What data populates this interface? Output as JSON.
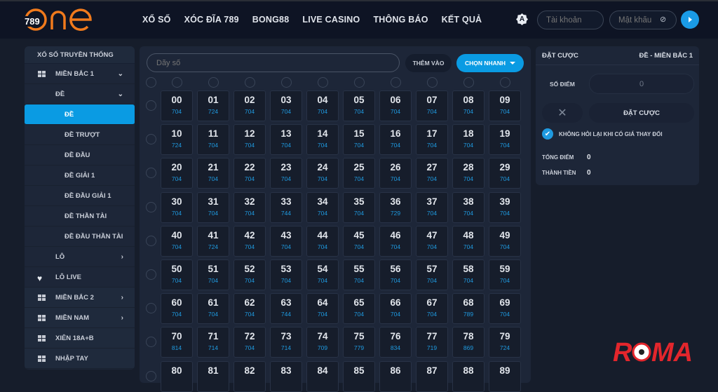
{
  "header": {
    "logo": {
      "prefix": "789",
      "word": "one"
    },
    "nav": [
      "XỔ SỐ",
      "XÓC ĐĨA 789",
      "BONG88",
      "LIVE CASINO",
      "THÔNG BÁO",
      "KẾT QUẢ"
    ],
    "lang_badge": "A",
    "username_placeholder": "Tài khoản",
    "password_placeholder": "Mật khẩu",
    "accent": "#1a9be6"
  },
  "sidebar": {
    "title": "XỔ SỐ TRUYỀN THỐNG",
    "items": [
      {
        "label": "MIỀN BẮC 1",
        "icon": "grid-icon",
        "chevron": "down",
        "level": 0
      },
      {
        "label": "ĐỀ",
        "chevron": "down",
        "level": 1
      },
      {
        "label": "ĐỀ",
        "level": 2,
        "active": true
      },
      {
        "label": "ĐỀ TRƯỢT",
        "level": 2
      },
      {
        "label": "ĐỀ ĐẦU",
        "level": 2
      },
      {
        "label": "ĐỀ GIẢI 1",
        "level": 2
      },
      {
        "label": "ĐỀ ĐẦU GIẢI 1",
        "level": 2
      },
      {
        "label": "ĐỀ THẦN TÀI",
        "level": 2
      },
      {
        "label": "ĐỀ ĐẦU THẦN TÀI",
        "level": 2
      },
      {
        "label": "LÔ",
        "chevron": "right",
        "level": 1
      },
      {
        "label": "LÔ LIVE",
        "icon": "heart-icon",
        "level": 0
      },
      {
        "label": "MIỀN BẮC 2",
        "icon": "grid-icon",
        "chevron": "right",
        "level": 0,
        "top": true
      },
      {
        "label": "MIỀN NAM",
        "icon": "grid-icon",
        "chevron": "right",
        "level": 0,
        "top": true
      },
      {
        "label": "XIÊN 18A+B",
        "icon": "grid-icon",
        "level": 0,
        "top": true
      },
      {
        "label": "NHẬP TAY",
        "icon": "grid-icon",
        "level": 0,
        "top": true
      }
    ]
  },
  "main": {
    "number_input_placeholder": "Dãy số",
    "add_label": "THÊM VÀO",
    "quick_pick_label": "CHỌN NHANH",
    "grid": [
      [
        "704",
        "724",
        "704",
        "704",
        "704",
        "704",
        "704",
        "704",
        "704",
        "704"
      ],
      [
        "724",
        "704",
        "704",
        "704",
        "704",
        "704",
        "704",
        "704",
        "704",
        "704"
      ],
      [
        "704",
        "704",
        "704",
        "704",
        "704",
        "704",
        "704",
        "704",
        "704",
        "704"
      ],
      [
        "704",
        "704",
        "704",
        "744",
        "704",
        "704",
        "729",
        "704",
        "704",
        "704"
      ],
      [
        "704",
        "724",
        "704",
        "704",
        "704",
        "704",
        "704",
        "704",
        "704",
        "704"
      ],
      [
        "704",
        "704",
        "704",
        "704",
        "704",
        "704",
        "704",
        "704",
        "704",
        "704"
      ],
      [
        "704",
        "704",
        "704",
        "744",
        "704",
        "704",
        "704",
        "704",
        "789",
        "704"
      ],
      [
        "814",
        "714",
        "704",
        "714",
        "709",
        "779",
        "834",
        "719",
        "869",
        "724"
      ],
      []
    ]
  },
  "bet": {
    "title": "ĐẶT CƯỢC",
    "market": "ĐỀ - MIỀN BẮC 1",
    "points_label": "SỐ ĐIỂM",
    "points_value": "0",
    "submit_label": "ĐẶT CƯỢC",
    "no_ask_label": "KHÔNG HỎI LẠI KHI CÓ GIÁ THAY ĐỔI",
    "no_ask_checked": true,
    "total_points_label": "TỔNG ĐIỂM",
    "total_points": "0",
    "amount_label": "THÀNH TIỀN",
    "amount": "0"
  },
  "watermark": "ROMA"
}
